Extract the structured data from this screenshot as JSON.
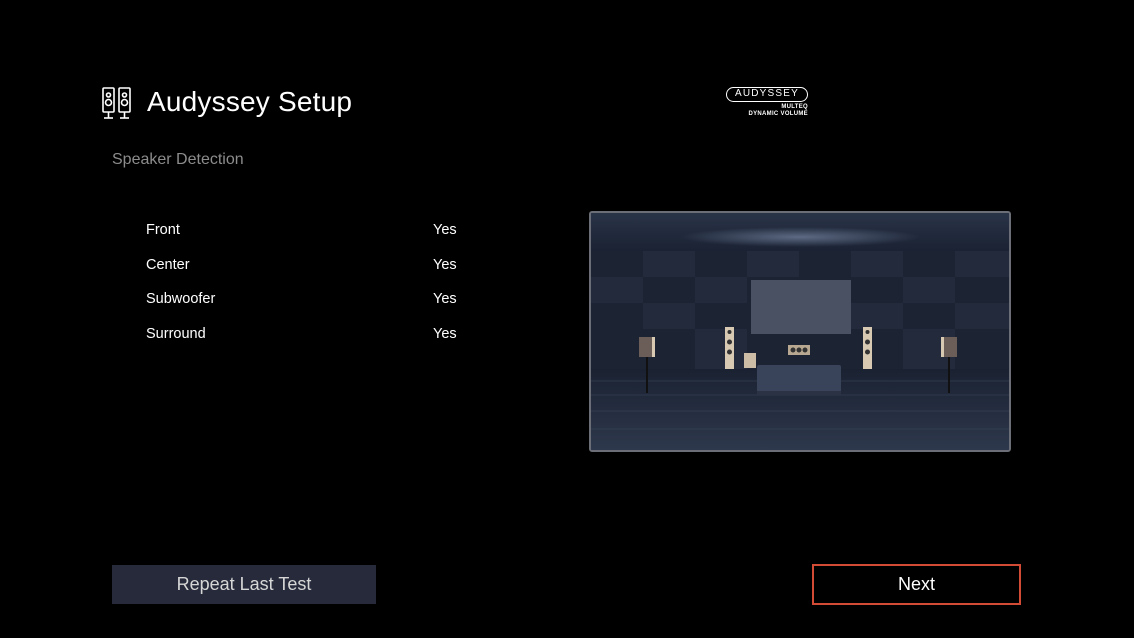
{
  "header": {
    "title": "Audyssey Setup",
    "subtitle": "Speaker Detection",
    "icon": "speakers-icon"
  },
  "logo": {
    "badge": "AUDYSSEY",
    "line1": "MULTEQ",
    "line2": "DYNAMIC VOLUME"
  },
  "speakers": [
    {
      "name": "Front",
      "value": "Yes"
    },
    {
      "name": "Center",
      "value": "Yes"
    },
    {
      "name": "Subwoofer",
      "value": "Yes"
    },
    {
      "name": "Surround",
      "value": "Yes"
    }
  ],
  "buttons": {
    "repeat_label": "Repeat Last Test",
    "next_label": "Next"
  },
  "colors": {
    "background": "#000000",
    "accent_focus": "#d24b34",
    "button_bg": "#262a3b",
    "subtitle": "#8c8c8c"
  }
}
